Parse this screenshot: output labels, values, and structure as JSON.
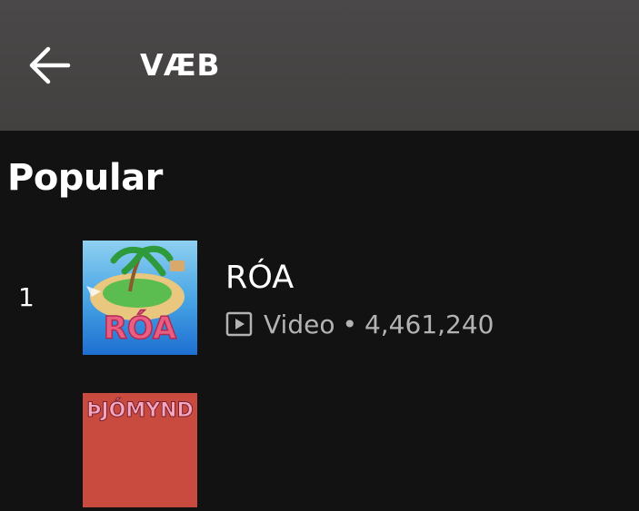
{
  "header": {
    "title": "VÆB",
    "back_icon": "arrow-left-icon"
  },
  "section": {
    "title": "Popular"
  },
  "tracks": [
    {
      "rank": "1",
      "name": "RÓA",
      "type_icon": "video-play-icon",
      "type": "Video",
      "separator": "•",
      "plays": "4,461,240",
      "cover_text": "RÓA"
    },
    {
      "rank": "",
      "name": "",
      "cover_text": "ÞJÓMYND"
    }
  ],
  "colors": {
    "background": "#121212",
    "header": "#474545",
    "secondary_text": "#b3b3b3"
  }
}
